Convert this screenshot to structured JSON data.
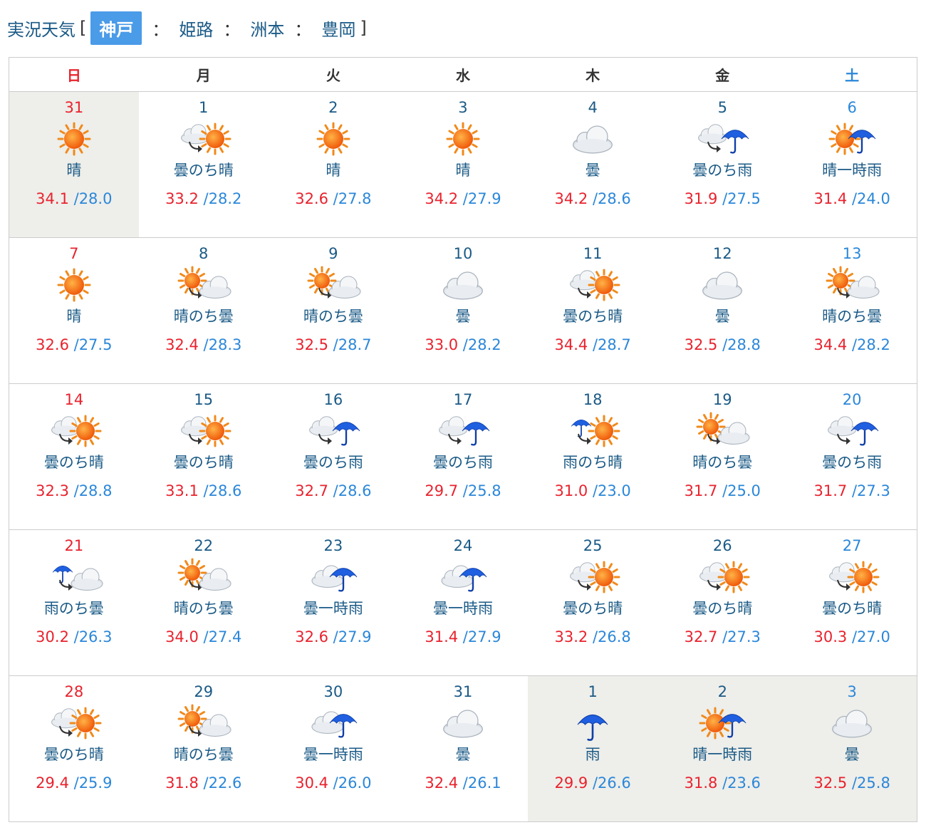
{
  "header": {
    "title": "実況天気",
    "open_bracket": "[",
    "close_bracket": "]",
    "separator": "：",
    "locations": [
      {
        "label": "神戸",
        "active": true
      },
      {
        "label": "姫路",
        "active": false
      },
      {
        "label": "洲本",
        "active": false
      },
      {
        "label": "豊岡",
        "active": false
      }
    ]
  },
  "weekdays": [
    "日",
    "月",
    "火",
    "水",
    "木",
    "金",
    "土"
  ],
  "weeks": [
    [
      {
        "day": "31",
        "icon": "sun",
        "label": "晴",
        "hi": "34.1",
        "lo": "/28.0",
        "other": true
      },
      {
        "day": "1",
        "icon": "cloud-then-sun",
        "label": "曇のち晴",
        "hi": "33.2",
        "lo": "/28.2"
      },
      {
        "day": "2",
        "icon": "sun",
        "label": "晴",
        "hi": "32.6",
        "lo": "/27.8"
      },
      {
        "day": "3",
        "icon": "sun",
        "label": "晴",
        "hi": "34.2",
        "lo": "/27.9"
      },
      {
        "day": "4",
        "icon": "cloud",
        "label": "曇",
        "hi": "34.2",
        "lo": "/28.6"
      },
      {
        "day": "5",
        "icon": "cloud-then-rain",
        "label": "曇のち雨",
        "hi": "31.9",
        "lo": "/27.5"
      },
      {
        "day": "6",
        "icon": "sun-occasional-rain",
        "label": "晴一時雨",
        "hi": "31.4",
        "lo": "/24.0"
      }
    ],
    [
      {
        "day": "7",
        "icon": "sun",
        "label": "晴",
        "hi": "32.6",
        "lo": "/27.5"
      },
      {
        "day": "8",
        "icon": "sun-then-cloud",
        "label": "晴のち曇",
        "hi": "32.4",
        "lo": "/28.3"
      },
      {
        "day": "9",
        "icon": "sun-then-cloud",
        "label": "晴のち曇",
        "hi": "32.5",
        "lo": "/28.7"
      },
      {
        "day": "10",
        "icon": "cloud",
        "label": "曇",
        "hi": "33.0",
        "lo": "/28.2"
      },
      {
        "day": "11",
        "icon": "cloud-then-sun",
        "label": "曇のち晴",
        "hi": "34.4",
        "lo": "/28.7"
      },
      {
        "day": "12",
        "icon": "cloud",
        "label": "曇",
        "hi": "32.5",
        "lo": "/28.8"
      },
      {
        "day": "13",
        "icon": "sun-then-cloud",
        "label": "晴のち曇",
        "hi": "34.4",
        "lo": "/28.2"
      }
    ],
    [
      {
        "day": "14",
        "icon": "cloud-then-sun",
        "label": "曇のち晴",
        "hi": "32.3",
        "lo": "/28.8"
      },
      {
        "day": "15",
        "icon": "cloud-then-sun",
        "label": "曇のち晴",
        "hi": "33.1",
        "lo": "/28.6"
      },
      {
        "day": "16",
        "icon": "cloud-then-rain",
        "label": "曇のち雨",
        "hi": "32.7",
        "lo": "/28.6"
      },
      {
        "day": "17",
        "icon": "cloud-then-rain",
        "label": "曇のち雨",
        "hi": "29.7",
        "lo": "/25.8"
      },
      {
        "day": "18",
        "icon": "rain-then-sun",
        "label": "雨のち晴",
        "hi": "31.0",
        "lo": "/23.0"
      },
      {
        "day": "19",
        "icon": "sun-then-cloud",
        "label": "晴のち曇",
        "hi": "31.7",
        "lo": "/25.0"
      },
      {
        "day": "20",
        "icon": "cloud-then-rain",
        "label": "曇のち雨",
        "hi": "31.7",
        "lo": "/27.3"
      }
    ],
    [
      {
        "day": "21",
        "icon": "rain-then-cloud",
        "label": "雨のち曇",
        "hi": "30.2",
        "lo": "/26.3"
      },
      {
        "day": "22",
        "icon": "sun-then-cloud",
        "label": "晴のち曇",
        "hi": "34.0",
        "lo": "/27.4"
      },
      {
        "day": "23",
        "icon": "cloud-occasional-rain",
        "label": "曇一時雨",
        "hi": "32.6",
        "lo": "/27.9"
      },
      {
        "day": "24",
        "icon": "cloud-occasional-rain",
        "label": "曇一時雨",
        "hi": "31.4",
        "lo": "/27.9"
      },
      {
        "day": "25",
        "icon": "cloud-then-sun",
        "label": "曇のち晴",
        "hi": "33.2",
        "lo": "/26.8"
      },
      {
        "day": "26",
        "icon": "cloud-then-sun",
        "label": "曇のち晴",
        "hi": "32.7",
        "lo": "/27.3"
      },
      {
        "day": "27",
        "icon": "cloud-then-sun",
        "label": "曇のち晴",
        "hi": "30.3",
        "lo": "/27.0"
      }
    ],
    [
      {
        "day": "28",
        "icon": "cloud-then-sun",
        "label": "曇のち晴",
        "hi": "29.4",
        "lo": "/25.9"
      },
      {
        "day": "29",
        "icon": "sun-then-cloud",
        "label": "晴のち曇",
        "hi": "31.8",
        "lo": "/22.6"
      },
      {
        "day": "30",
        "icon": "cloud-occasional-rain",
        "label": "曇一時雨",
        "hi": "30.4",
        "lo": "/26.0"
      },
      {
        "day": "31",
        "icon": "cloud",
        "label": "曇",
        "hi": "32.4",
        "lo": "/26.1"
      },
      {
        "day": "1",
        "icon": "rain",
        "label": "雨",
        "hi": "29.9",
        "lo": "/26.6",
        "other": true
      },
      {
        "day": "2",
        "icon": "sun-occasional-rain",
        "label": "晴一時雨",
        "hi": "31.8",
        "lo": "/23.6",
        "other": true
      },
      {
        "day": "3",
        "icon": "cloud",
        "label": "曇",
        "hi": "32.5",
        "lo": "/25.8",
        "other": true
      }
    ]
  ],
  "colors": {
    "sunday": "#e8232e",
    "saturday": "#2b87d9",
    "high_temp": "#e8232e",
    "low_temp": "#2b87d9",
    "active_tab": "#4a9be8",
    "other_month_bg": "#eeeeea"
  }
}
